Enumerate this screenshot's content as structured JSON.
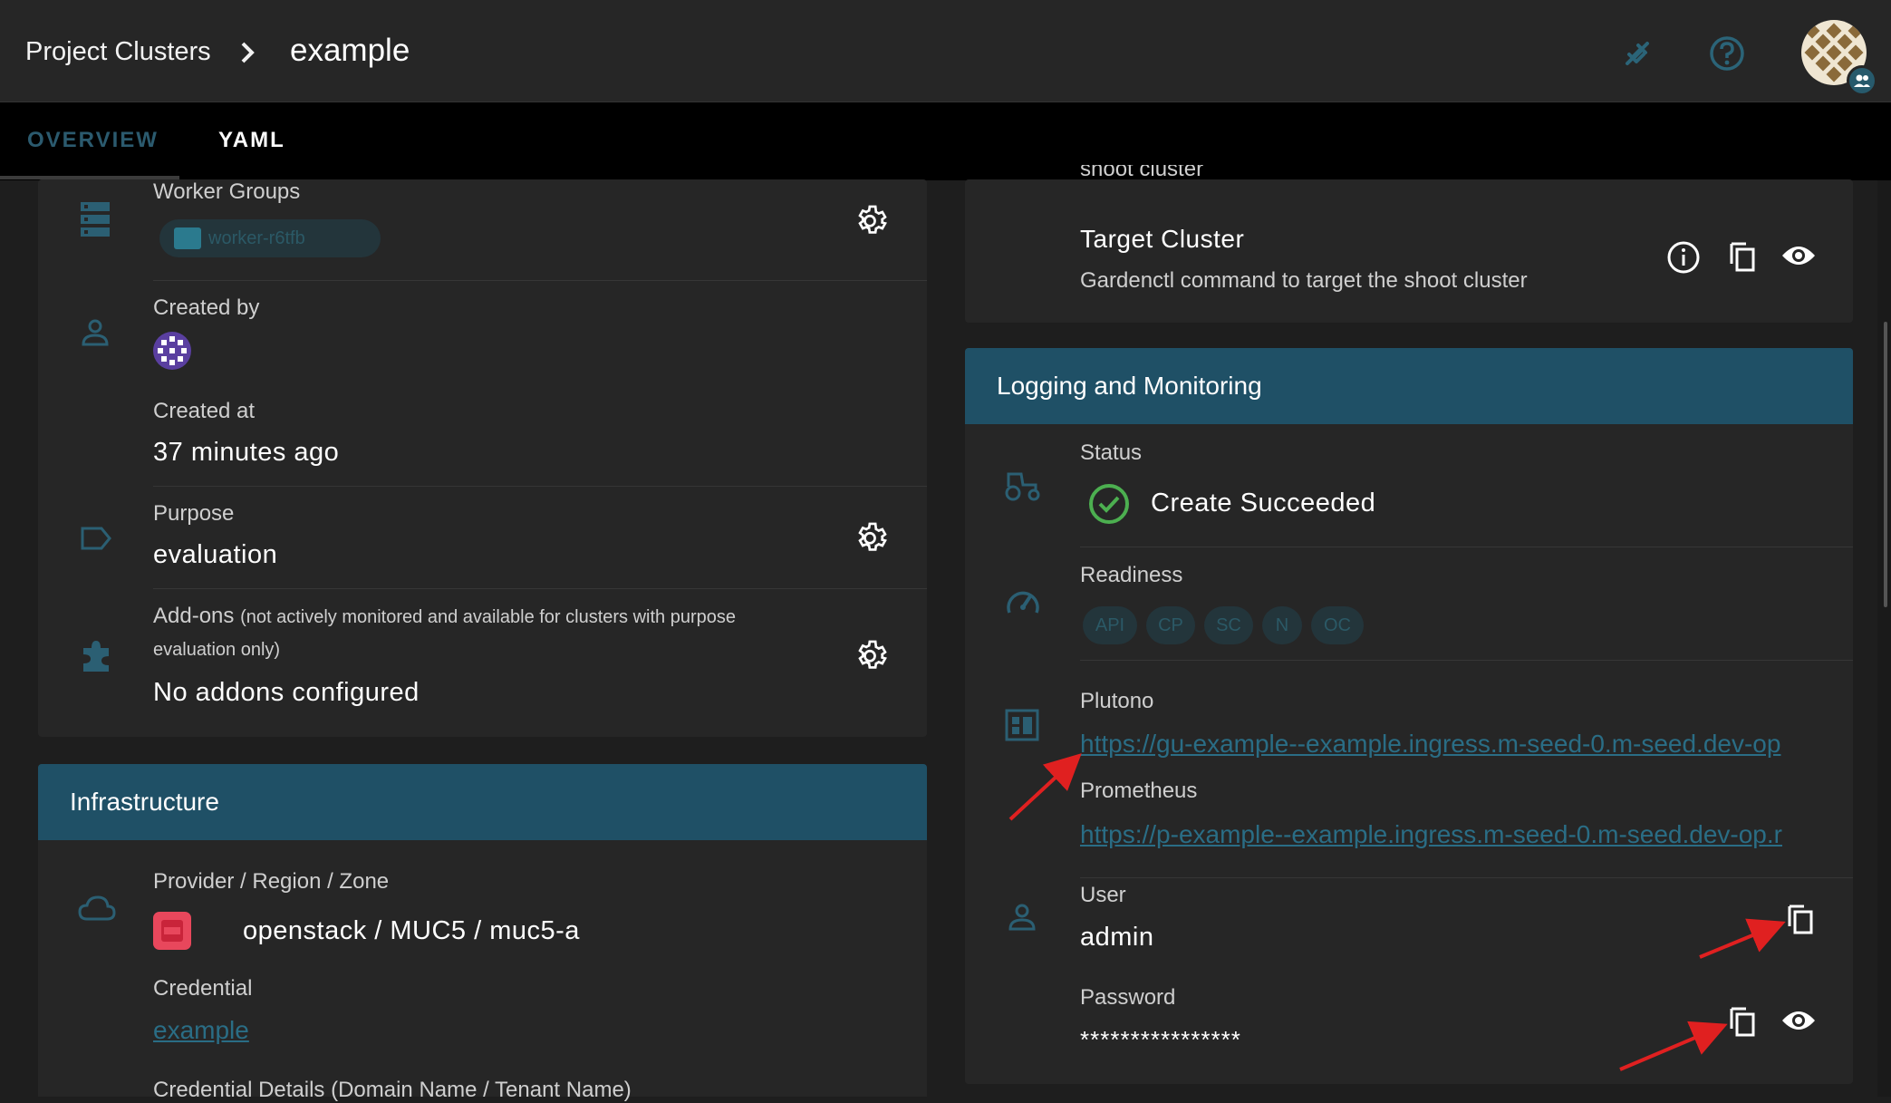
{
  "header": {
    "breadcrumb_root": "Project Clusters",
    "breadcrumb_current": "example",
    "icons": [
      "plug-icon",
      "help-icon",
      "avatar"
    ]
  },
  "tabs": [
    {
      "label": "OVERVIEW",
      "active": false
    },
    {
      "label": "YAML",
      "active": true
    }
  ],
  "left": {
    "worker_groups": {
      "label": "Worker Groups",
      "chip": "worker-r6tfb"
    },
    "created_by": {
      "label": "Created by"
    },
    "created_at": {
      "label": "Created at",
      "value": "37 minutes ago"
    },
    "purpose": {
      "label": "Purpose",
      "value": "evaluation"
    },
    "addons": {
      "label": "Add-ons",
      "note": "(not actively monitored and available for clusters with purpose",
      "note2": "evaluation only)",
      "value": "No addons configured"
    },
    "infrastructure": {
      "title": "Infrastructure",
      "provider_label": "Provider / Region / Zone",
      "provider_value": "openstack / MUC5 / muc5-a",
      "credential_label": "Credential",
      "credential_value": "example",
      "credential_details_label": "Credential Details (Domain Name / Tenant Name)"
    }
  },
  "right": {
    "partial_top_text": "shoot cluster",
    "target_cluster": {
      "title": "Target Cluster",
      "description": "Gardenctl command to target the shoot cluster"
    },
    "logging": {
      "title": "Logging and Monitoring",
      "status_label": "Status",
      "status_value": "Create Succeeded",
      "readiness_label": "Readiness",
      "readiness_chips": [
        "API",
        "CP",
        "SC",
        "N",
        "OC"
      ],
      "plutono_label": "Plutono",
      "plutono_url": "https://gu-example--example.ingress.m-seed-0.m-seed.dev-op",
      "prometheus_label": "Prometheus",
      "prometheus_url": "https://p-example--example.ingress.m-seed-0.m-seed.dev-op.r",
      "user_label": "User",
      "user_value": "admin",
      "password_label": "Password",
      "password_value": "****************"
    }
  },
  "colors": {
    "accent": "#1f5066",
    "success": "#4caf50",
    "annotation_arrow": "#e02020"
  }
}
